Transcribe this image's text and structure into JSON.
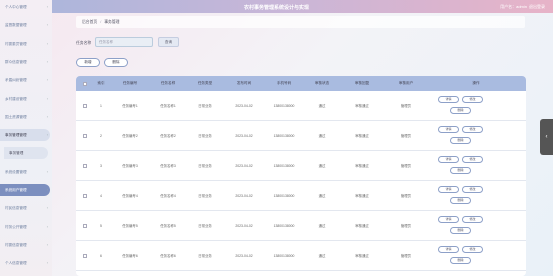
{
  "header": {
    "title": "农村事务管理系统设计与实现",
    "user": "用户名：admin",
    "logout": "退出登录"
  },
  "sidebar": {
    "items": [
      {
        "label": "个人中心管理",
        "state": ""
      },
      {
        "label": "监督数据管理",
        "state": ""
      },
      {
        "label": "村委委员管理",
        "state": ""
      },
      {
        "label": "群众信息管理",
        "state": ""
      },
      {
        "label": "矛盾纠纷管理",
        "state": ""
      },
      {
        "label": "乡村建设管理",
        "state": ""
      },
      {
        "label": "国土资源管理",
        "state": ""
      },
      {
        "label": "事务管理管理",
        "state": "active"
      },
      {
        "label": "事务管理",
        "state": "sub"
      },
      {
        "label": "系统设置管理",
        "state": ""
      },
      {
        "label": "系统用户管理",
        "state": "highlight"
      },
      {
        "label": "村民信息管理",
        "state": ""
      },
      {
        "label": "村务公开管理",
        "state": ""
      },
      {
        "label": "村委信息管理",
        "state": ""
      },
      {
        "label": "个人信息管理",
        "state": ""
      }
    ]
  },
  "breadcrumb": {
    "home": "后台首页",
    "current": "事务管理"
  },
  "search": {
    "label": "任务名称",
    "placeholder": "任务名称",
    "button": "查询"
  },
  "actions": {
    "add": "新增",
    "delete": "删除"
  },
  "table": {
    "headers": [
      "",
      "索引",
      "任务编号",
      "任务名称",
      "任务类型",
      "发布时间",
      "手机号码",
      "审核状态",
      "审核回复",
      "审核用户",
      "操作"
    ],
    "rows": [
      [
        "",
        "1",
        "任务编号1",
        "任务名称1",
        "日常业务",
        "2023-04-02",
        "13800138000",
        "通过",
        "审核通过",
        "管理员",
        ""
      ],
      [
        "",
        "2",
        "任务编号2",
        "任务名称2",
        "日常业务",
        "2023-04-02",
        "13800138000",
        "通过",
        "审核通过",
        "管理员",
        ""
      ],
      [
        "",
        "3",
        "任务编号3",
        "任务名称3",
        "日常业务",
        "2023-04-02",
        "13800138000",
        "通过",
        "审核通过",
        "管理员",
        ""
      ],
      [
        "",
        "4",
        "任务编号4",
        "任务名称4",
        "日常业务",
        "2023-04-02",
        "13800138000",
        "通过",
        "审核通过",
        "管理员",
        ""
      ],
      [
        "",
        "5",
        "任务编号5",
        "任务名称5",
        "日常业务",
        "2023-04-02",
        "13800138000",
        "通过",
        "审核通过",
        "管理员",
        ""
      ],
      [
        "",
        "6",
        "任务编号6",
        "任务名称6",
        "日常业务",
        "2023-04-02",
        "13800138000",
        "通过",
        "审核通过",
        "管理员",
        ""
      ]
    ],
    "ops": {
      "detail": "详情",
      "edit": "修改",
      "remove": "删除"
    }
  },
  "side_tab": {
    "icon": "chevron-left-icon",
    "glyph": "‹"
  }
}
